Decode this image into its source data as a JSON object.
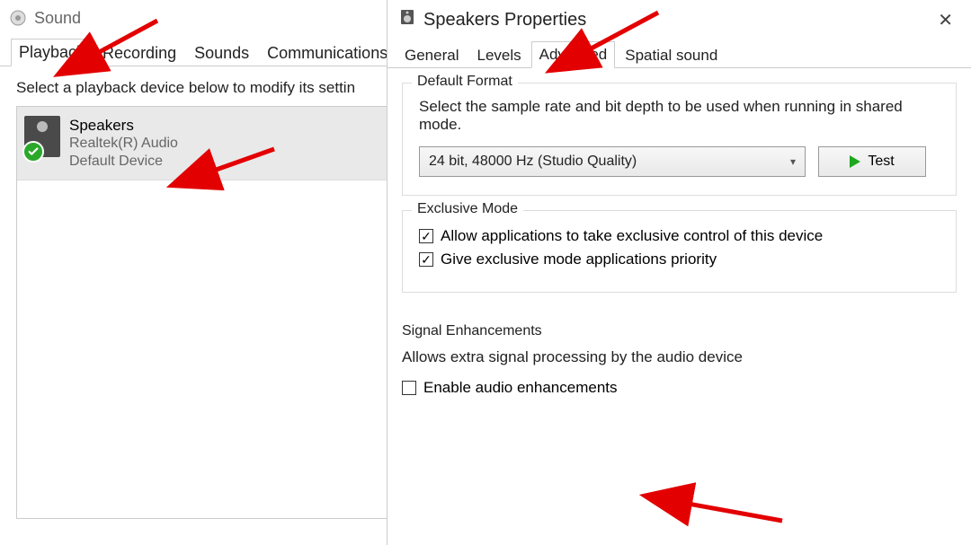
{
  "sound_window": {
    "title": "Sound",
    "instruction": "Select a playback device below to modify its settin",
    "tabs": [
      "Playback",
      "Recording",
      "Sounds",
      "Communications"
    ],
    "active_tab": 0,
    "device": {
      "name": "Speakers",
      "driver": "Realtek(R) Audio",
      "status": "Default Device"
    }
  },
  "props_window": {
    "title": "Speakers Properties",
    "tabs": [
      "General",
      "Levels",
      "Advanced",
      "Spatial sound"
    ],
    "active_tab": 2,
    "default_format": {
      "legend": "Default Format",
      "desc": "Select the sample rate and bit depth to be used when running in shared mode.",
      "selected": "24 bit, 48000 Hz (Studio Quality)",
      "test_label": "Test"
    },
    "exclusive_mode": {
      "legend": "Exclusive Mode",
      "opt1": "Allow applications to take exclusive control of this device",
      "opt1_checked": true,
      "opt2": "Give exclusive mode applications priority",
      "opt2_checked": true
    },
    "signal": {
      "legend": "Signal Enhancements",
      "desc": "Allows extra signal processing by the audio device",
      "opt": "Enable audio enhancements",
      "opt_checked": false
    }
  }
}
